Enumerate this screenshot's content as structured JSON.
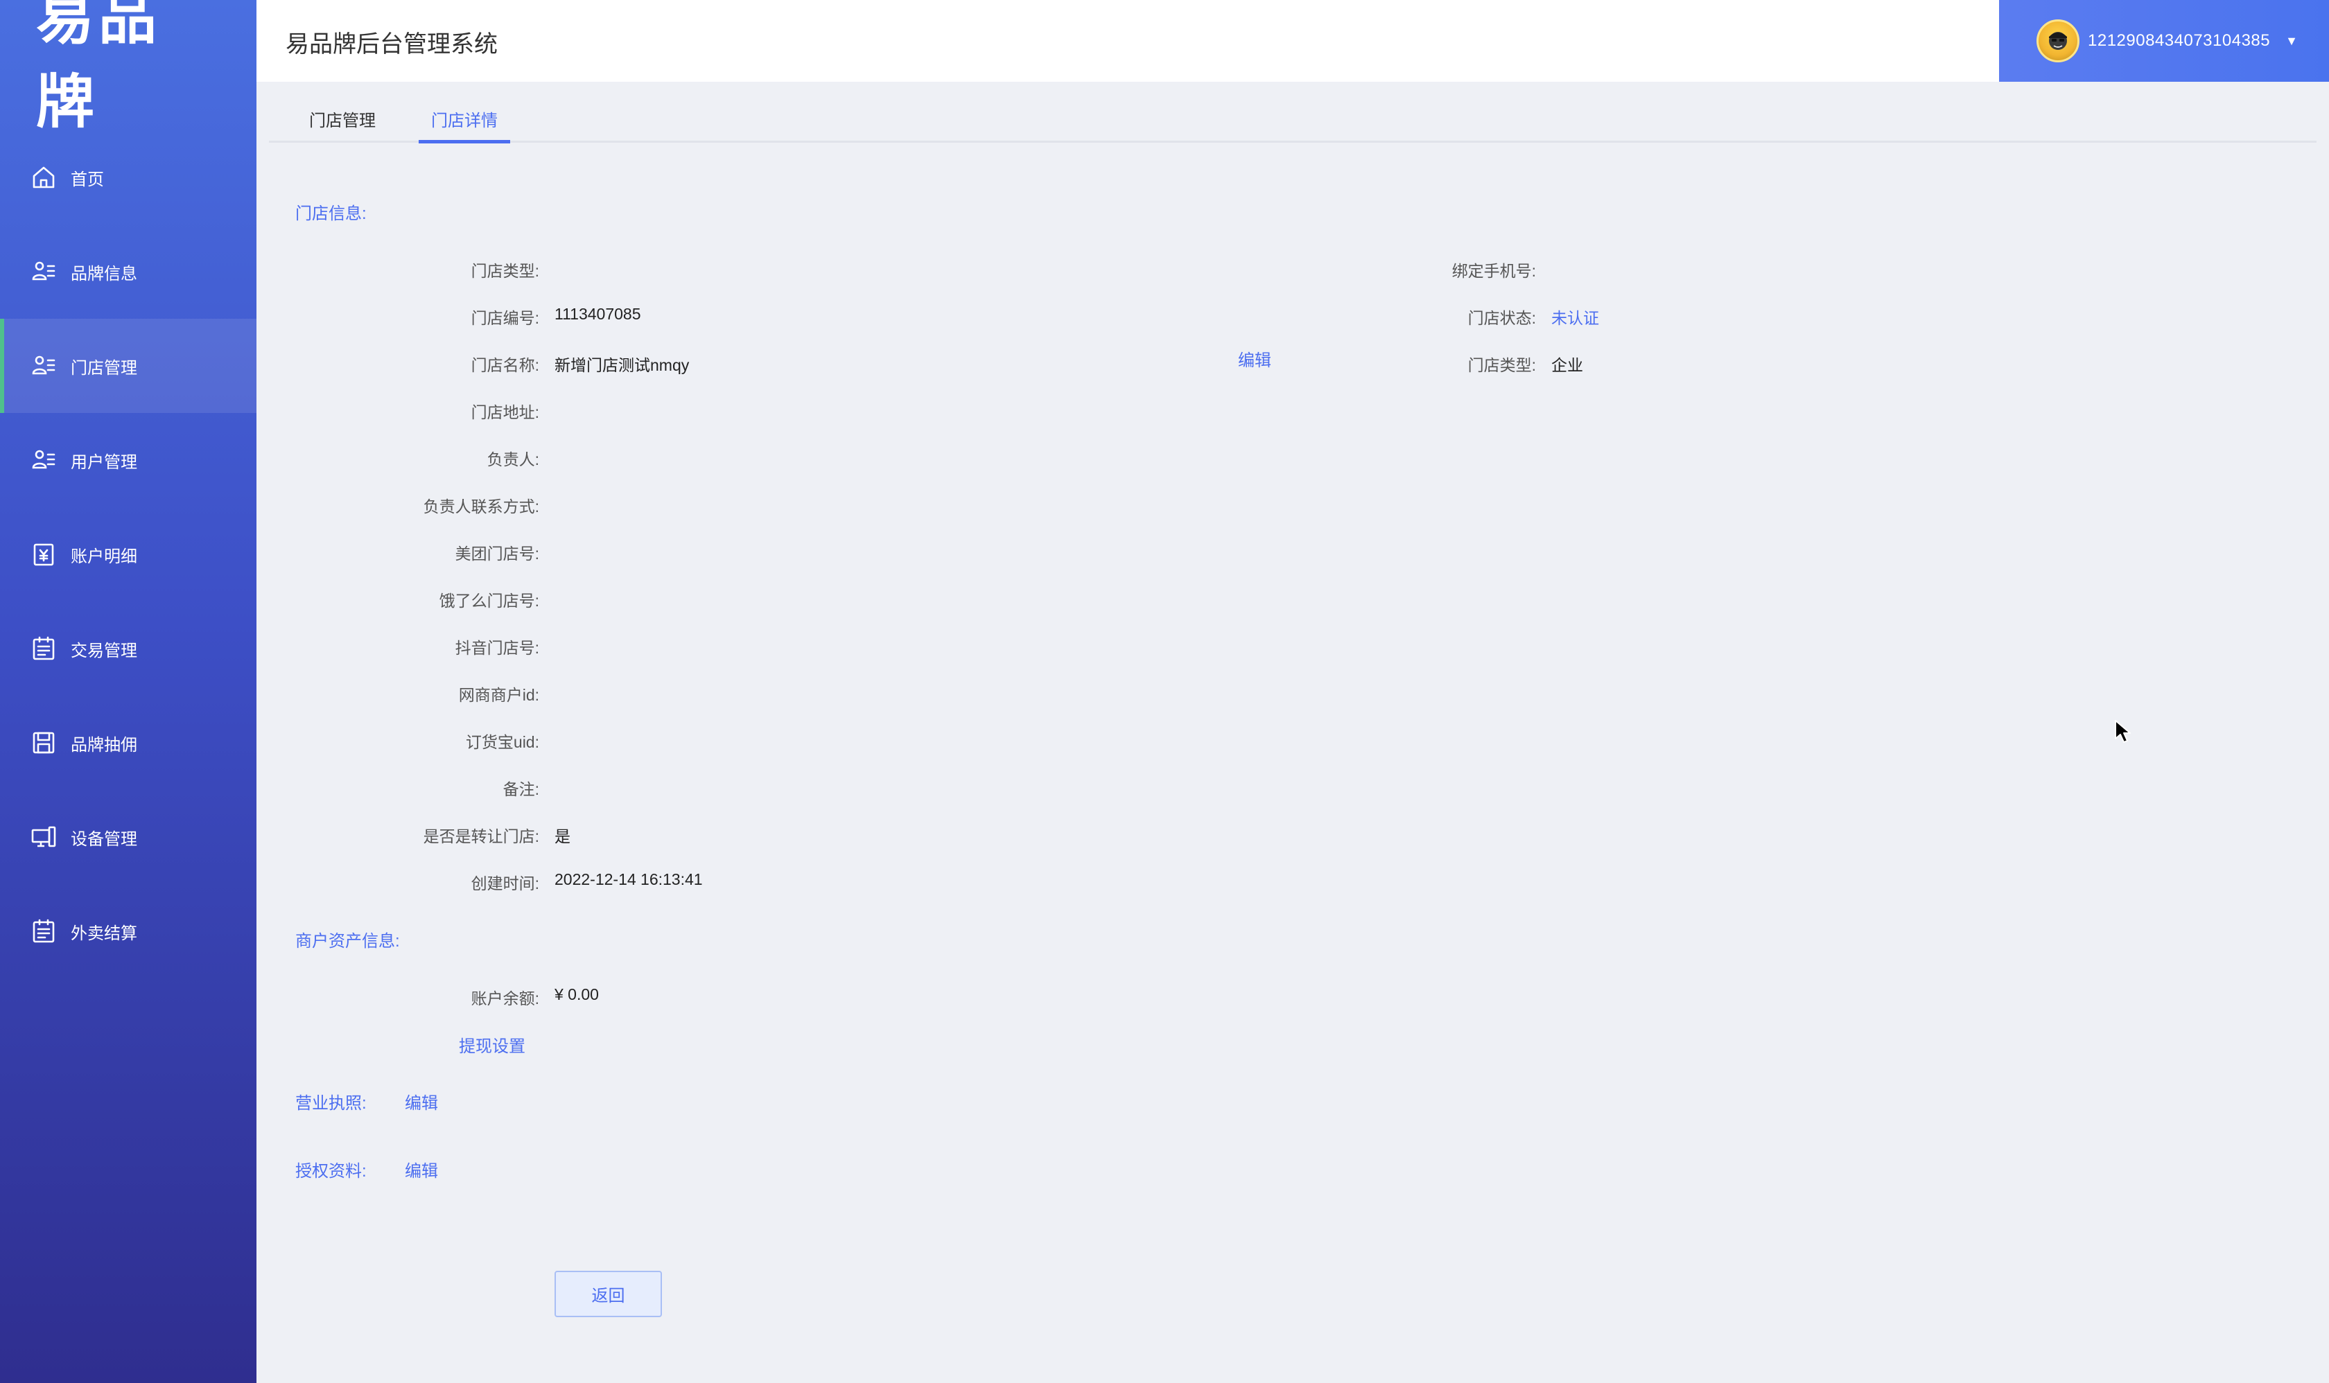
{
  "logo": {
    "text": "易品牌"
  },
  "header": {
    "title": "易品牌后台管理系统"
  },
  "user": {
    "name": "1212908434073104385",
    "caret": "▼"
  },
  "sidebar": {
    "items": [
      {
        "label": "首页",
        "icon": "home-icon"
      },
      {
        "label": "品牌信息",
        "icon": "user-list-icon"
      },
      {
        "label": "门店管理",
        "icon": "user-list-icon",
        "active": true
      },
      {
        "label": "用户管理",
        "icon": "user-list-icon"
      },
      {
        "label": "账户明细",
        "icon": "wallet-yen-icon"
      },
      {
        "label": "交易管理",
        "icon": "clipboard-icon"
      },
      {
        "label": "品牌抽佣",
        "icon": "save-icon"
      },
      {
        "label": "设备管理",
        "icon": "device-icon"
      },
      {
        "label": "外卖结算",
        "icon": "clipboard-icon"
      }
    ]
  },
  "tabs": [
    {
      "label": "门店管理"
    },
    {
      "label": "门店详情",
      "active": true
    }
  ],
  "store_info": {
    "title": "门店信息:",
    "fields": [
      {
        "label": "门店类型:",
        "value": ""
      },
      {
        "label": "门店编号:",
        "value": "1113407085"
      },
      {
        "label": "门店名称:",
        "value": "新增门店测试nmqy"
      },
      {
        "label": "门店地址:",
        "value": ""
      },
      {
        "label": "负责人:",
        "value": ""
      },
      {
        "label": "负责人联系方式:",
        "value": ""
      },
      {
        "label": "美团门店号:",
        "value": ""
      },
      {
        "label": "饿了么门店号:",
        "value": ""
      },
      {
        "label": "抖音门店号:",
        "value": ""
      },
      {
        "label": "网商商户id:",
        "value": ""
      },
      {
        "label": "订货宝uid:",
        "value": ""
      },
      {
        "label": "备注:",
        "value": ""
      },
      {
        "label": "是否是转让门店:",
        "value": "是"
      },
      {
        "label": "创建时间:",
        "value": "2022-12-14 16:13:41"
      }
    ],
    "edit_link": "编辑",
    "right_fields": [
      {
        "label": "绑定手机号:",
        "value": ""
      },
      {
        "label": "门店状态:",
        "value": "未认证"
      },
      {
        "label": "门店类型:",
        "value": "企业"
      }
    ]
  },
  "asset_info": {
    "title": "商户资产信息:",
    "balance_label": "账户余额:",
    "balance_value": "¥ 0.00",
    "withdraw_link": "提现设置"
  },
  "license": {
    "title": "营业执照:",
    "edit": "编辑"
  },
  "auth": {
    "title": "授权资料:",
    "edit": "编辑"
  },
  "back_button": "返回",
  "colors": {
    "accent": "#4c6ef0",
    "sidebar_top": "#4a6fe0",
    "sidebar_bottom": "#2f2e8f",
    "active_marker": "#4fc08d"
  }
}
